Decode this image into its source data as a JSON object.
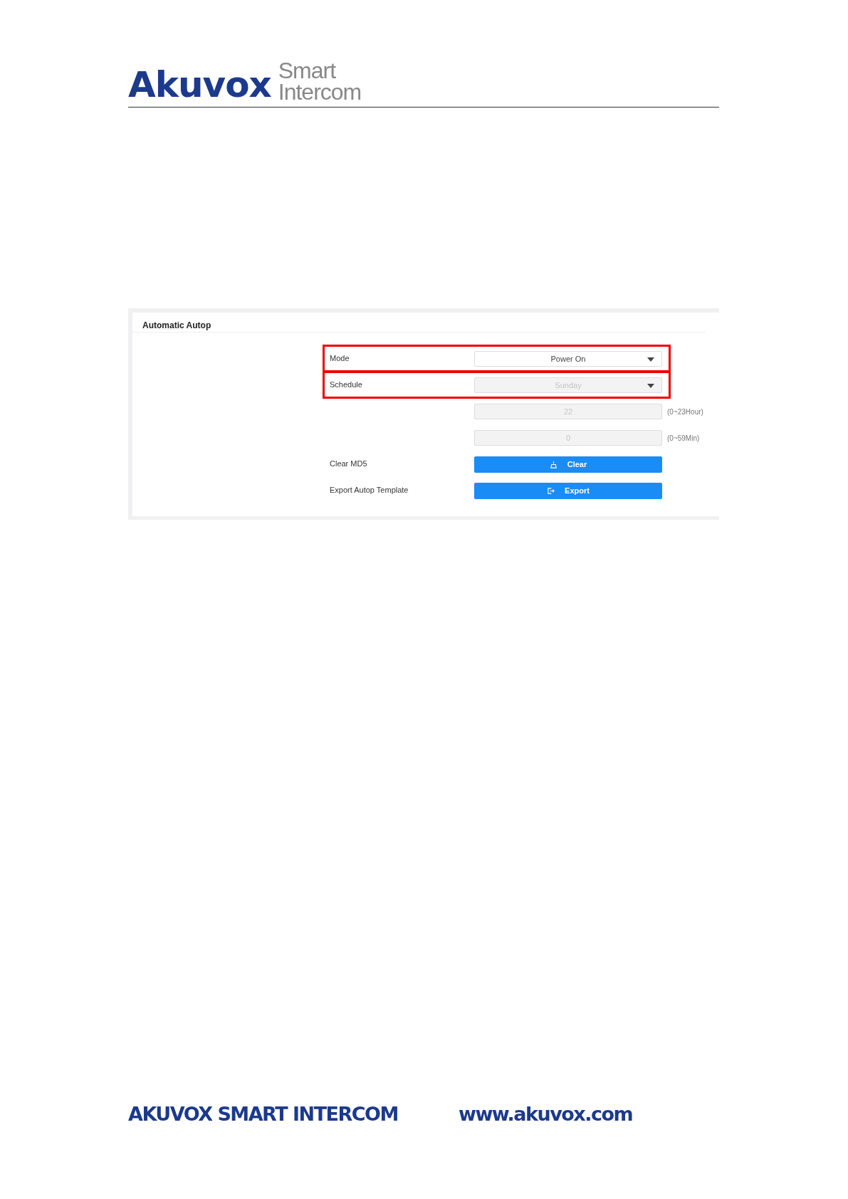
{
  "header": {
    "logo_brand": "Akuvox",
    "logo_tagline_1": "Smart",
    "logo_tagline_2": "Intercom"
  },
  "panel": {
    "title": "Automatic Autop",
    "rows": [
      {
        "kind": "select",
        "label": "Mode",
        "value": "Power On",
        "disabled": false,
        "highlighted": true
      },
      {
        "kind": "select",
        "label": "Schedule",
        "value": "Sunday",
        "disabled": true,
        "highlighted": true
      },
      {
        "kind": "input",
        "value": "22",
        "hint": "(0~23Hour)",
        "disabled": true,
        "highlighted": false
      },
      {
        "kind": "input",
        "value": "0",
        "hint": "(0~59Min)",
        "disabled": true,
        "highlighted": false
      },
      {
        "kind": "button",
        "label": "Clear MD5",
        "button": "Clear",
        "highlighted": false
      },
      {
        "kind": "button",
        "label": "Export Autop Template",
        "button": "Export",
        "highlighted": false
      }
    ]
  },
  "footer": {
    "company": "AKUVOX SMART INTERCOM",
    "website": "www.akuvox.com"
  }
}
